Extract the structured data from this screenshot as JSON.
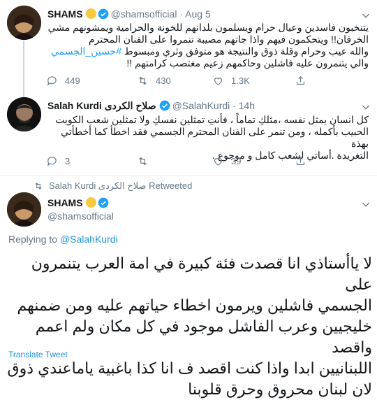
{
  "tweet1": {
    "name": "SHAMS",
    "handle": "@shamsofficial",
    "separator": "·",
    "time": "Aug 5",
    "lines": [
      "يتنخبون فاسدين وعيال حرام ويسلمون بلدانهم للخونة والحرامية  ويمشونهم مشي",
      "الخرفان!!  ويتحكمون فيهم  واذا جاتهم مصيبة تنمروا على الفنان المحترم",
      "والله عيب وحرام وقلة ذوق  والنتيجة هو متوفق وثري ومبسوط"
    ],
    "hashtag": "#حسين_الجسمي",
    "line4": "والي يتنمرون عليه  فاشلين وحاكمهم زعيم مغتصب كرامتهم !!",
    "replies": "449",
    "retweets": "430",
    "likes": "1.3K"
  },
  "tweet2": {
    "name": "Salah Kurdi",
    "name_ar": "صلاح الكردى",
    "handle": "@SalahKurdi",
    "separator": "·",
    "time": "14h",
    "lines": [
      "كل انسان يمثل نفسه ،مثلكِ تماماً ، فأنتِ تمثلين نفسكِ ولا تمثلين شعب الكويت",
      "الحبيب بأكمله ، ومن تنمر على الفنان المحترم الجسمي فقد اخطأ كما أخطأتي بهذة",
      "التغريدة .أساتي لشعب كامل و موجوع ."
    ],
    "replies": "3",
    "retweets": "",
    "likes": "39"
  },
  "retweet_banner": "Salah Kurdi صلاح الكردى Retweeted",
  "tweet3": {
    "name": "SHAMS",
    "handle": "@shamsofficial",
    "replying_prefix": "Replying to",
    "replying_to": "@SalahKurdi",
    "lines": [
      "لا ياأستاذي انا قصدت فئة كبيرة في امة العرب يتنمرون على",
      "الجسمي فاشلين ويرمون اخطاء حياتهم عليه ومن ضمنهم",
      "خليجيين وعرب  الفاشل موجود في كل مكان ولم اعمم واقصد",
      "اللبنانيين ابدا واذا كنت اقصد ف انا كذا باغبية ياماعندي ذوق",
      "لان لبنان محروق وحرق قلوبنا"
    ],
    "translate": "Translate Tweet"
  },
  "colors": {
    "accent": "#1da1f2",
    "secondary_text": "#657786",
    "divider": "#e6ecf0"
  },
  "icons": [
    "avatar",
    "sun-emoji-icon",
    "verified-icon",
    "chevron-down-icon",
    "reply-icon",
    "retweet-icon",
    "like-icon",
    "share-icon"
  ]
}
